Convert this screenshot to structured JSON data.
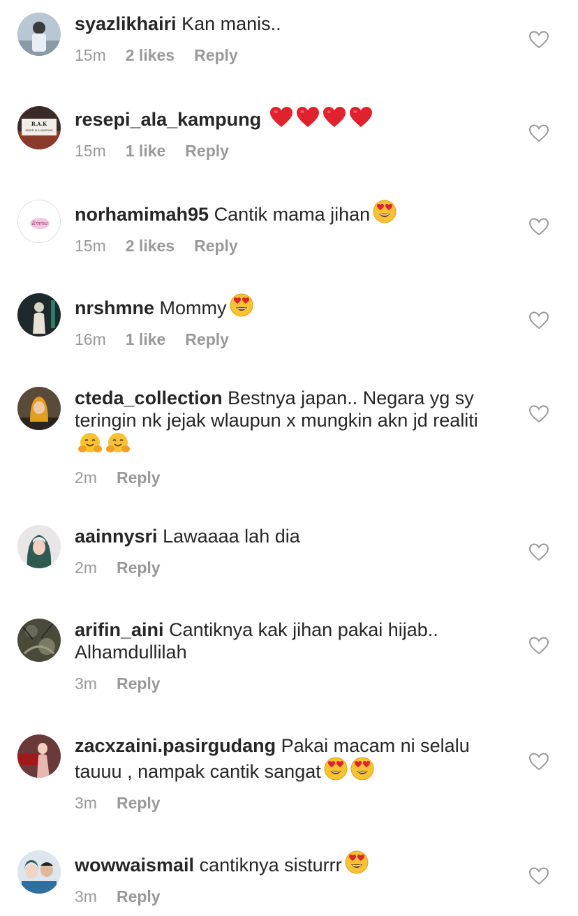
{
  "comments": [
    {
      "username": "syazlikhairi",
      "text": "Kan manis..",
      "time": "15m",
      "likes": "2 likes",
      "reply": "Reply",
      "emoji": []
    },
    {
      "username": "resepi_ala_kampung",
      "text": "",
      "time": "15m",
      "likes": "1 like",
      "reply": "Reply",
      "emoji": [
        "heart",
        "heart",
        "heart",
        "heart"
      ]
    },
    {
      "username": "norhamimah95",
      "text": "Cantik mama jihan",
      "time": "15m",
      "likes": "2 likes",
      "reply": "Reply",
      "emoji": [
        "heart-eyes"
      ]
    },
    {
      "username": "nrshmne",
      "text": "Mommy",
      "time": "16m",
      "likes": "1 like",
      "reply": "Reply",
      "emoji": [
        "heart-eyes"
      ]
    },
    {
      "username": "cteda_collection",
      "text": "Bestnya japan.. Negara yg sy teringin nk jejak wlaupun x mungkin akn jd realiti",
      "time": "2m",
      "likes": "",
      "reply": "Reply",
      "emoji": [
        "hug",
        "hug"
      ]
    },
    {
      "username": "aainnysri",
      "text": "Lawaaaa lah dia",
      "time": "2m",
      "likes": "",
      "reply": "Reply",
      "emoji": []
    },
    {
      "username": "arifin_aini",
      "text": "Cantiknya kak jihan pakai hijab.. Alhamdullilah",
      "time": "3m",
      "likes": "",
      "reply": "Reply",
      "emoji": []
    },
    {
      "username": "zacxzaini.pasirgudang",
      "text": "Pakai macam ni selalu tauuu , nampak cantik sangat",
      "time": "3m",
      "likes": "",
      "reply": "Reply",
      "emoji": [
        "heart-eyes",
        "heart-eyes"
      ]
    },
    {
      "username": "wowwaismail",
      "text": "cantiknya sisturrr",
      "time": "3m",
      "likes": "",
      "reply": "Reply",
      "emoji": [
        "heart-eyes"
      ]
    }
  ],
  "avatar_overlay": {
    "resepi_badge": "R.A.K",
    "resepi_sub": "RESEPI ALA KAMPUNG",
    "norhamimah_script": "Emma"
  },
  "colors": {
    "text": "#262626",
    "meta": "#999999",
    "heart_outline": "#999999",
    "red": "#e0222e",
    "emoji_yellow": "#f7c233"
  }
}
